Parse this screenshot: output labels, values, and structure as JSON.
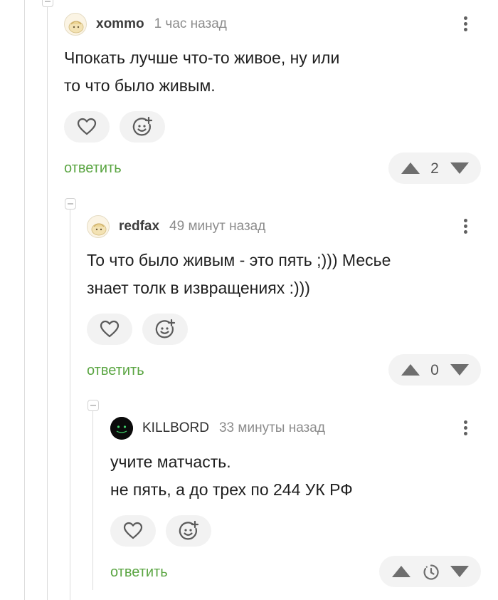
{
  "comments": [
    {
      "username": "xommo",
      "time": "1 час назад",
      "lines": [
        "Чпокать лучше что-то живое, ну или",
        "то что было живым."
      ],
      "reply_label": "ответить",
      "rating": "2"
    },
    {
      "username": "redfax",
      "time": "49 минут назад",
      "lines": [
        "То что было живым - это пять ;))) Месье",
        "знает толк в извращениях :)))"
      ],
      "reply_label": "ответить",
      "rating": "0"
    },
    {
      "username": "KILLBORD",
      "time": "33 минуты назад",
      "lines": [
        "учите матчасть.",
        "не пять, а до трех по 244 УК РФ"
      ],
      "reply_label": "ответить",
      "rating_state": "pending"
    }
  ],
  "icons": {
    "like": "heart-icon",
    "react": "emoji-add-icon",
    "upvote": "triangle-up-icon",
    "downvote": "triangle-down-icon",
    "pending_rating": "clock-icon",
    "menu": "kebab-menu-icon"
  },
  "colors": {
    "reply_link": "#5aa542",
    "vote_arrow": "#6e6e6e",
    "button_bg": "#f2f2f2",
    "thread_line": "#dcdcdc"
  }
}
